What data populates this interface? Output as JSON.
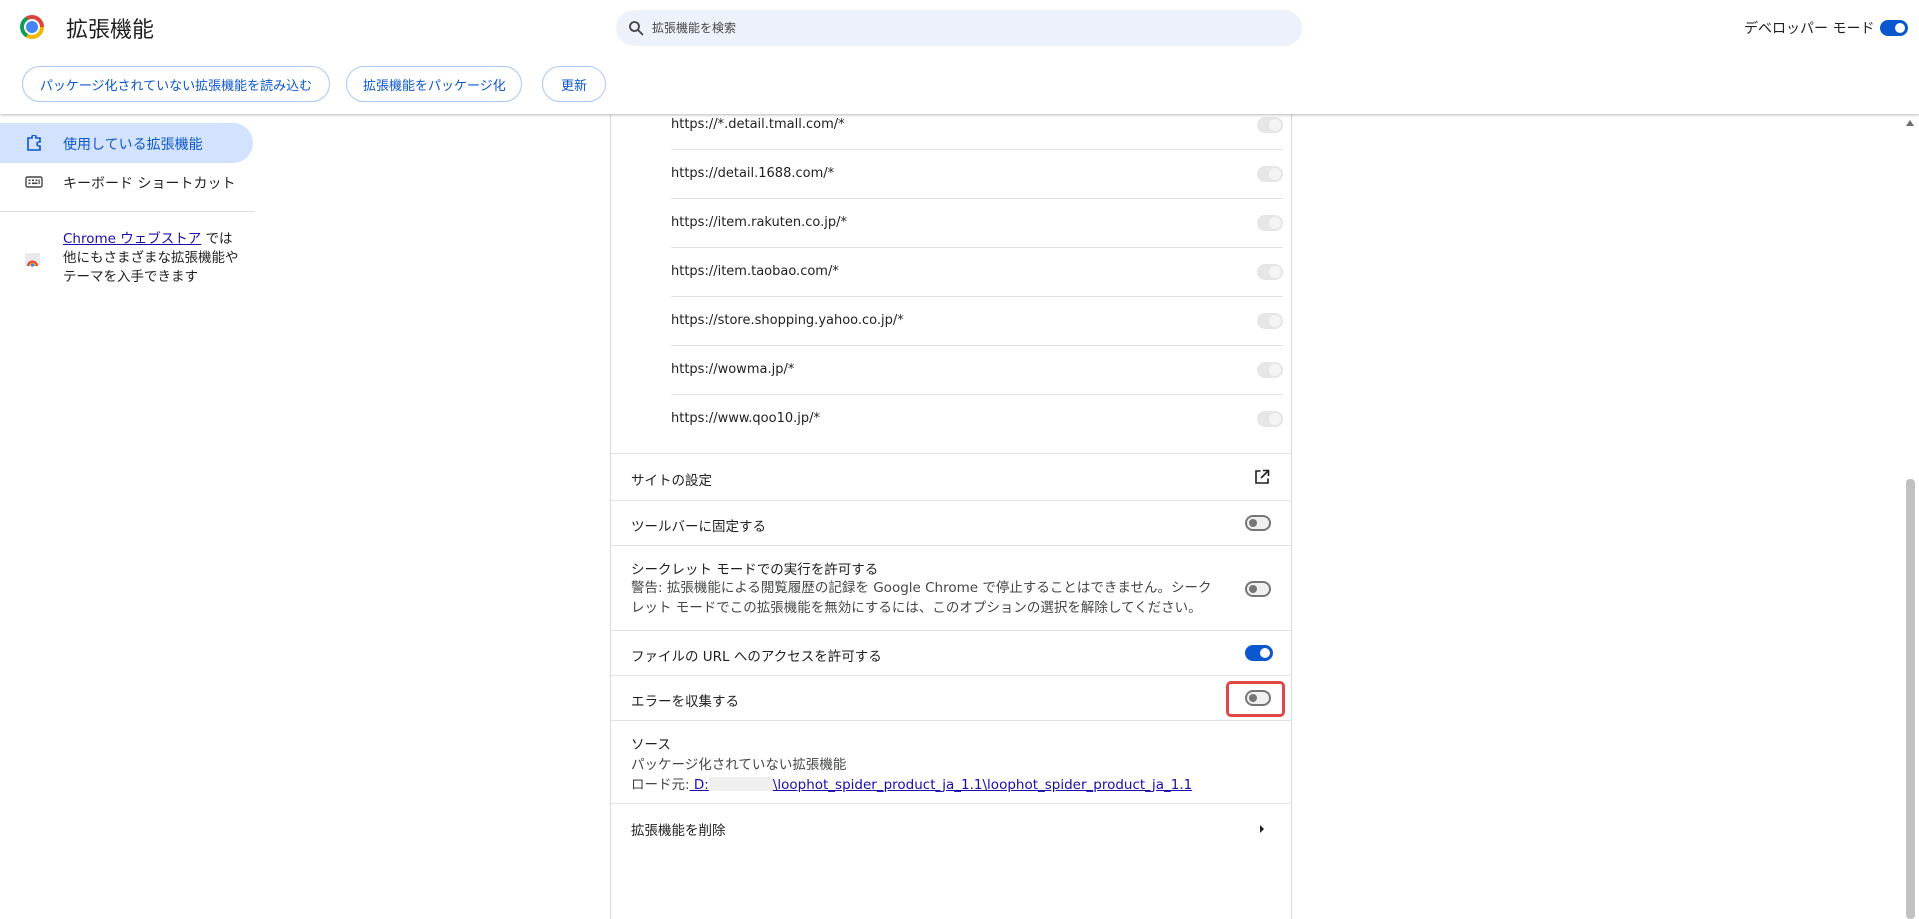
{
  "header": {
    "title": "拡張機能",
    "search_placeholder": "拡張機能を検索",
    "dev_mode_label": "デベロッパー モード",
    "dev_mode_on": true
  },
  "toolbar": {
    "load_unpacked": "パッケージ化されていない拡張機能を読み込む",
    "pack": "拡張機能をパッケージ化",
    "update": "更新"
  },
  "sidebar": {
    "items": [
      {
        "label": "使用している拡張機能",
        "icon": "puzzle-icon",
        "selected": true
      },
      {
        "label": "キーボード ショートカット",
        "icon": "keyboard-icon",
        "selected": false
      }
    ],
    "store_link": "Chrome ウェブストア",
    "store_text": " では他にもさまざまな拡張機能やテーマを入手できます"
  },
  "site_access": [
    "https://*.detail.tmall.com/*",
    "https://detail.1688.com/*",
    "https://item.rakuten.co.jp/*",
    "https://item.taobao.com/*",
    "https://store.shopping.yahoo.co.jp/*",
    "https://wowma.jp/*",
    "https://www.qoo10.jp/*"
  ],
  "settings": {
    "site_settings": "サイトの設定",
    "pin_toolbar": "ツールバーに固定する",
    "pin_toolbar_on": false,
    "incognito": "シークレット モードでの実行を許可する",
    "incognito_warning": "警告: 拡張機能による閲覧履歴の記録を Google Chrome で停止することはできません。シークレット モードでこの拡張機能を無効にするには、このオプションの選択を解除してください。",
    "incognito_on": false,
    "file_url": "ファイルの URL へのアクセスを許可する",
    "file_url_on": true,
    "collect_errors": "エラーを収集する",
    "collect_errors_on": false
  },
  "source": {
    "title": "ソース",
    "type": "パッケージ化されていない拡張機能",
    "load_from_label": "ロード元:",
    "drive": " D:",
    "path": "\\loophot_spider_product_ja_1.1\\loophot_spider_product_ja_1.1"
  },
  "remove_label": "拡張機能を削除",
  "colors": {
    "accent": "#0b57d0",
    "selected_nav_bg": "#d3e3fd",
    "highlight": "#e04848"
  }
}
